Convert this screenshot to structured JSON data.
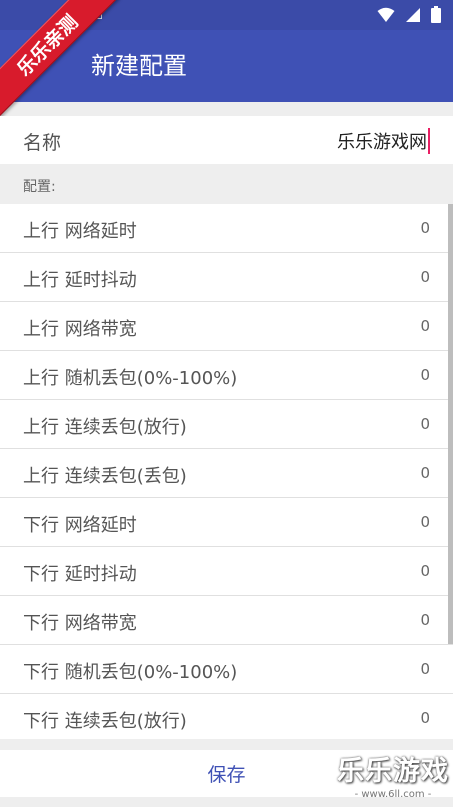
{
  "app": {
    "title": "新建配置"
  },
  "watermark": {
    "ribbon": "乐乐亲测",
    "brand": "乐乐游戏",
    "url": "- www.6ll.com -"
  },
  "name": {
    "label": "名称",
    "value": "乐乐游戏网"
  },
  "section": {
    "label": "配置:"
  },
  "items": [
    {
      "label": "上行 网络延时",
      "value": "0"
    },
    {
      "label": "上行 延时抖动",
      "value": "0"
    },
    {
      "label": "上行 网络带宽",
      "value": "0"
    },
    {
      "label": "上行 随机丢包(0%-100%)",
      "value": "0"
    },
    {
      "label": "上行 连续丢包(放行)",
      "value": "0"
    },
    {
      "label": "上行 连续丢包(丢包)",
      "value": "0"
    },
    {
      "label": "下行 网络延时",
      "value": "0"
    },
    {
      "label": "下行 延时抖动",
      "value": "0"
    },
    {
      "label": "下行 网络带宽",
      "value": "0"
    },
    {
      "label": "下行 随机丢包(0%-100%)",
      "value": "0"
    },
    {
      "label": "下行 连续丢包(放行)",
      "value": "0"
    }
  ],
  "actions": {
    "save_label": "保存"
  },
  "colors": {
    "primary": "#3f51b5",
    "statusbar": "#3b4ba8",
    "accent": "#e91e63",
    "ribbon": "#d81b2c"
  },
  "icons": {
    "back": "arrow-back-icon",
    "wifi": "wifi-icon",
    "signal": "signal-icon",
    "battery": "battery-icon",
    "keyboard": "keyboard-icon"
  }
}
